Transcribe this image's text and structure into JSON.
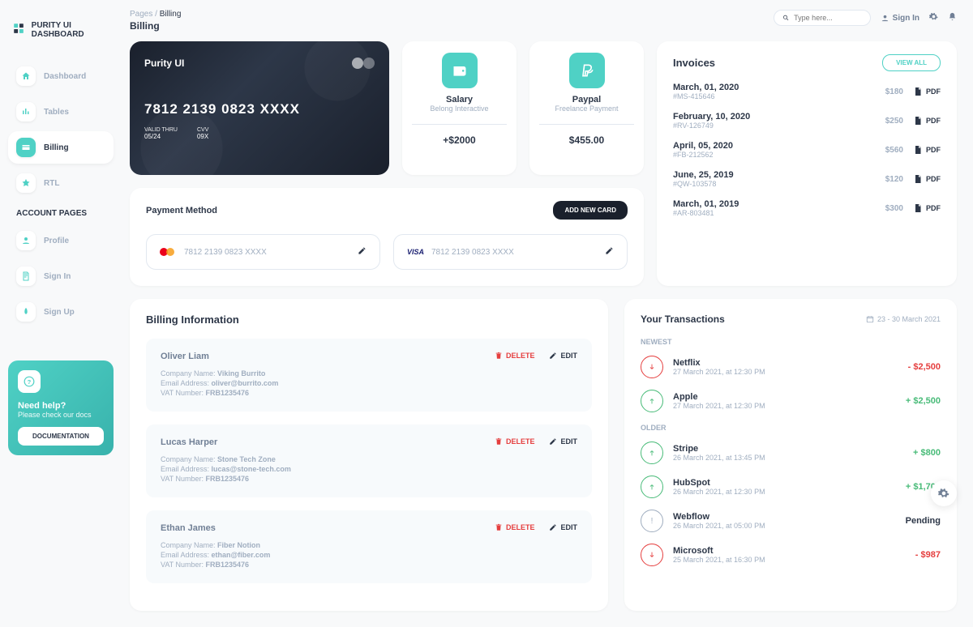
{
  "brand": "PURITY UI DASHBOARD",
  "nav": {
    "items": [
      {
        "label": "Dashboard"
      },
      {
        "label": "Tables"
      },
      {
        "label": "Billing"
      },
      {
        "label": "RTL"
      }
    ],
    "section": "ACCOUNT PAGES",
    "account": [
      {
        "label": "Profile"
      },
      {
        "label": "Sign In"
      },
      {
        "label": "Sign Up"
      }
    ]
  },
  "help": {
    "title": "Need help?",
    "sub": "Please check our docs",
    "btn": "DOCUMENTATION"
  },
  "breadcrumb": {
    "root": "Pages",
    "current": "Billing"
  },
  "page_title": "Billing",
  "search": {
    "placeholder": "Type here..."
  },
  "signin": "Sign In",
  "credit": {
    "brand": "Purity UI",
    "number": "7812 2139 0823 XXXX",
    "thru_lbl": "VALID THRU",
    "thru": "05/24",
    "cvv_lbl": "CVV",
    "cvv": "09X"
  },
  "stat1": {
    "title": "Salary",
    "sub": "Belong Interactive",
    "value": "+$2000"
  },
  "stat2": {
    "title": "Paypal",
    "sub": "Freelance Payment",
    "value": "$455.00"
  },
  "invoices": {
    "title": "Invoices",
    "viewall": "VIEW ALL",
    "pdf": "PDF",
    "items": [
      {
        "date": "March, 01, 2020",
        "code": "#MS-415646",
        "amount": "$180"
      },
      {
        "date": "February, 10, 2020",
        "code": "#RV-126749",
        "amount": "$250"
      },
      {
        "date": "April, 05, 2020",
        "code": "#FB-212562",
        "amount": "$560"
      },
      {
        "date": "June, 25, 2019",
        "code": "#QW-103578",
        "amount": "$120"
      },
      {
        "date": "March, 01, 2019",
        "code": "#AR-803481",
        "amount": "$300"
      }
    ]
  },
  "pm": {
    "title": "Payment Method",
    "add": "ADD NEW CARD",
    "cards": [
      {
        "num": "7812 2139 0823 XXXX"
      },
      {
        "num": "7812 2139 0823 XXXX"
      }
    ]
  },
  "billing": {
    "title": "Billing Information",
    "delete": "DELETE",
    "edit": "EDIT",
    "company_lbl": "Company Name:",
    "email_lbl": "Email Address:",
    "vat_lbl": "VAT Number:",
    "items": [
      {
        "name": "Oliver Liam",
        "company": "Viking Burrito",
        "email": "oliver@burrito.com",
        "vat": "FRB1235476"
      },
      {
        "name": "Lucas Harper",
        "company": "Stone Tech Zone",
        "email": "lucas@stone-tech.com",
        "vat": "FRB1235476"
      },
      {
        "name": "Ethan James",
        "company": "Fiber Notion",
        "email": "ethan@fiber.com",
        "vat": "FRB1235476"
      }
    ]
  },
  "trans": {
    "title": "Your Transactions",
    "range": "23 - 30 March 2021",
    "newest": "NEWEST",
    "older": "OLDER",
    "pending": "Pending",
    "newest_items": [
      {
        "name": "Netflix",
        "time": "27 March 2021, at 12:30 PM",
        "amount": "- $2,500",
        "dir": "down"
      },
      {
        "name": "Apple",
        "time": "27 March 2021, at 12:30 PM",
        "amount": "+ $2,500",
        "dir": "up"
      }
    ],
    "older_items": [
      {
        "name": "Stripe",
        "time": "26 March 2021, at 13:45 PM",
        "amount": "+ $800",
        "dir": "up"
      },
      {
        "name": "HubSpot",
        "time": "26 March 2021, at 12:30 PM",
        "amount": "+ $1,700",
        "dir": "up"
      },
      {
        "name": "Webflow",
        "time": "26 March 2021, at 05:00 PM",
        "amount": "Pending",
        "dir": "neutral"
      },
      {
        "name": "Microsoft",
        "time": "25 March 2021, at 16:30 PM",
        "amount": "- $987",
        "dir": "down"
      }
    ]
  }
}
